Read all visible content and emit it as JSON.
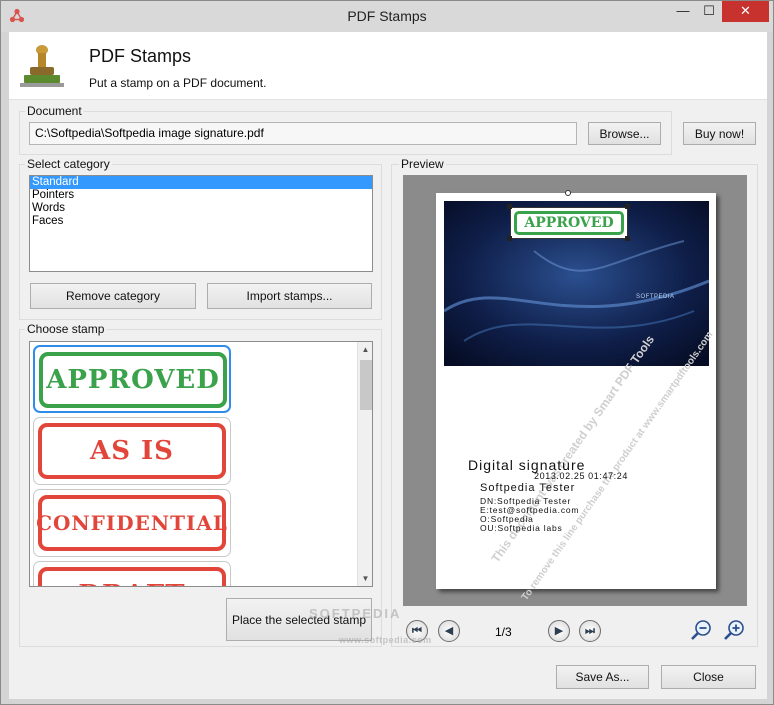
{
  "window": {
    "title": "PDF Stamps",
    "controls": {
      "minimize": "—",
      "maximize": "☐",
      "close": "✕"
    }
  },
  "header": {
    "title": "PDF Stamps",
    "subtitle": "Put a stamp on a PDF document."
  },
  "document": {
    "group_label": "Document",
    "path": "C:\\Softpedia\\Softpedia image signature.pdf",
    "browse_label": "Browse...",
    "buy_label": "Buy now!"
  },
  "category": {
    "group_label": "Select category",
    "items": [
      "Standard",
      "Pointers",
      "Words",
      "Faces"
    ],
    "selected": "Standard",
    "remove_label": "Remove category",
    "import_label": "Import stamps..."
  },
  "stamps": {
    "group_label": "Choose stamp",
    "items": [
      "APPROVED",
      "AS IS",
      "CONFIDENTIAL",
      "DRAFT"
    ],
    "place_label": "Place the selected stamp"
  },
  "preview": {
    "group_label": "Preview",
    "page_counter": "1/3",
    "page_stamp": "APPROVED",
    "banner_brand": "SOFTPEDIA",
    "diag_line1": "This document was created by Smart PDF Tools",
    "diag_line2": "To remove this line purchase the product at www.smartpdftools.com",
    "signature_title": "Digital signature",
    "signature_date": "2013.02.25 01:47:24",
    "signature_name": "Softpedia Tester",
    "signature_lines": [
      "DN:Softpedia Tester",
      "E:test@softpedia.com",
      "O:Softpedia",
      "OU:Softpedia labs"
    ]
  },
  "footer": {
    "save_label": "Save As...",
    "close_label": "Close",
    "watermark_top": "SOFTPEDIA",
    "watermark_bottom": "www.softpedia.com"
  },
  "colors": {
    "selection": "#3399ff",
    "stamp_green": "#3aa24a",
    "stamp_red": "#e2463a",
    "close_red": "#c7322f"
  }
}
